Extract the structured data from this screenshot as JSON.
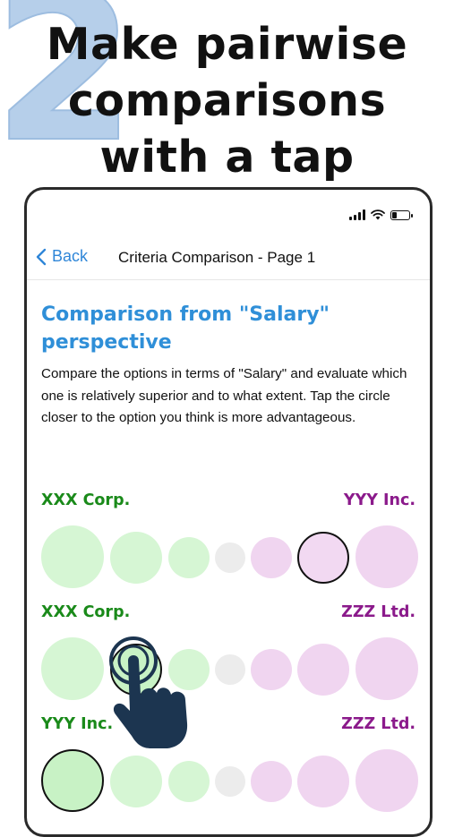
{
  "headline": {
    "number": "2",
    "line1": "Make pairwise",
    "line2": "comparisons",
    "line3": "with a tap"
  },
  "nav": {
    "back_label": "Back",
    "title": "Criteria Comparison - Page 1"
  },
  "content": {
    "section_title": "Comparison from \"Salary\" perspective",
    "description": "Compare the options in terms of \"Salary\" and evaluate which one is relatively superior and to what extent. Tap the circle closer to the option you think is more advantageous."
  },
  "comparisons": [
    {
      "left": "XXX Corp.",
      "right": "YYY Inc."
    },
    {
      "left": "XXX Corp.",
      "right": "ZZZ Ltd."
    },
    {
      "left": "YYY Inc.",
      "right": "ZZZ Ltd."
    }
  ],
  "colors": {
    "accent": "#2f8fd8",
    "left_option": "#1a8a1a",
    "right_option": "#8b1a8b",
    "left_circle": "#d6f6d4",
    "right_circle": "#f0d5f0",
    "neutral_circle": "#ececec"
  },
  "icons": [
    "signal-icon",
    "wifi-icon",
    "battery-icon",
    "chevron-left-icon",
    "pointing-hand-icon"
  ]
}
